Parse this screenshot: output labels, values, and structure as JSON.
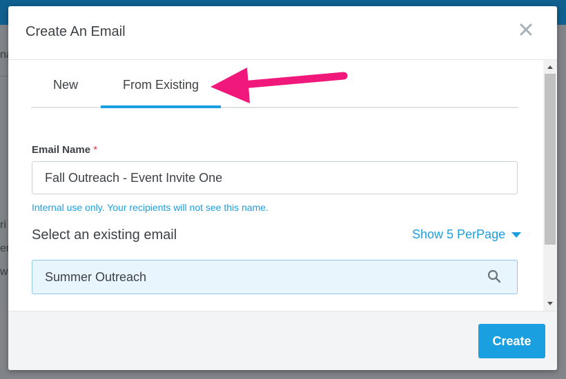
{
  "background": {
    "left_fragments": [
      "na",
      "ri",
      "er",
      "wi"
    ]
  },
  "modal": {
    "title": "Create An Email",
    "tabs": [
      {
        "label": "New",
        "active": false
      },
      {
        "label": "From Existing",
        "active": true
      }
    ],
    "email_name": {
      "label": "Email Name",
      "required_mark": "*",
      "value": "Fall Outreach - Event Invite One",
      "hint": "Internal use only. Your recipients will not see this name."
    },
    "select_existing": {
      "label": "Select an existing email",
      "per_page_label": "Show 5 PerPage"
    },
    "search": {
      "value": "Summer Outreach"
    },
    "footer": {
      "create_label": "Create"
    }
  },
  "colors": {
    "accent": "#1a9fe0",
    "annotation_arrow": "#f0187a",
    "required": "#e0334a"
  },
  "icons": [
    "close-icon",
    "search-icon",
    "chevron-down-icon",
    "scroll-up-icon",
    "scroll-down-icon"
  ]
}
